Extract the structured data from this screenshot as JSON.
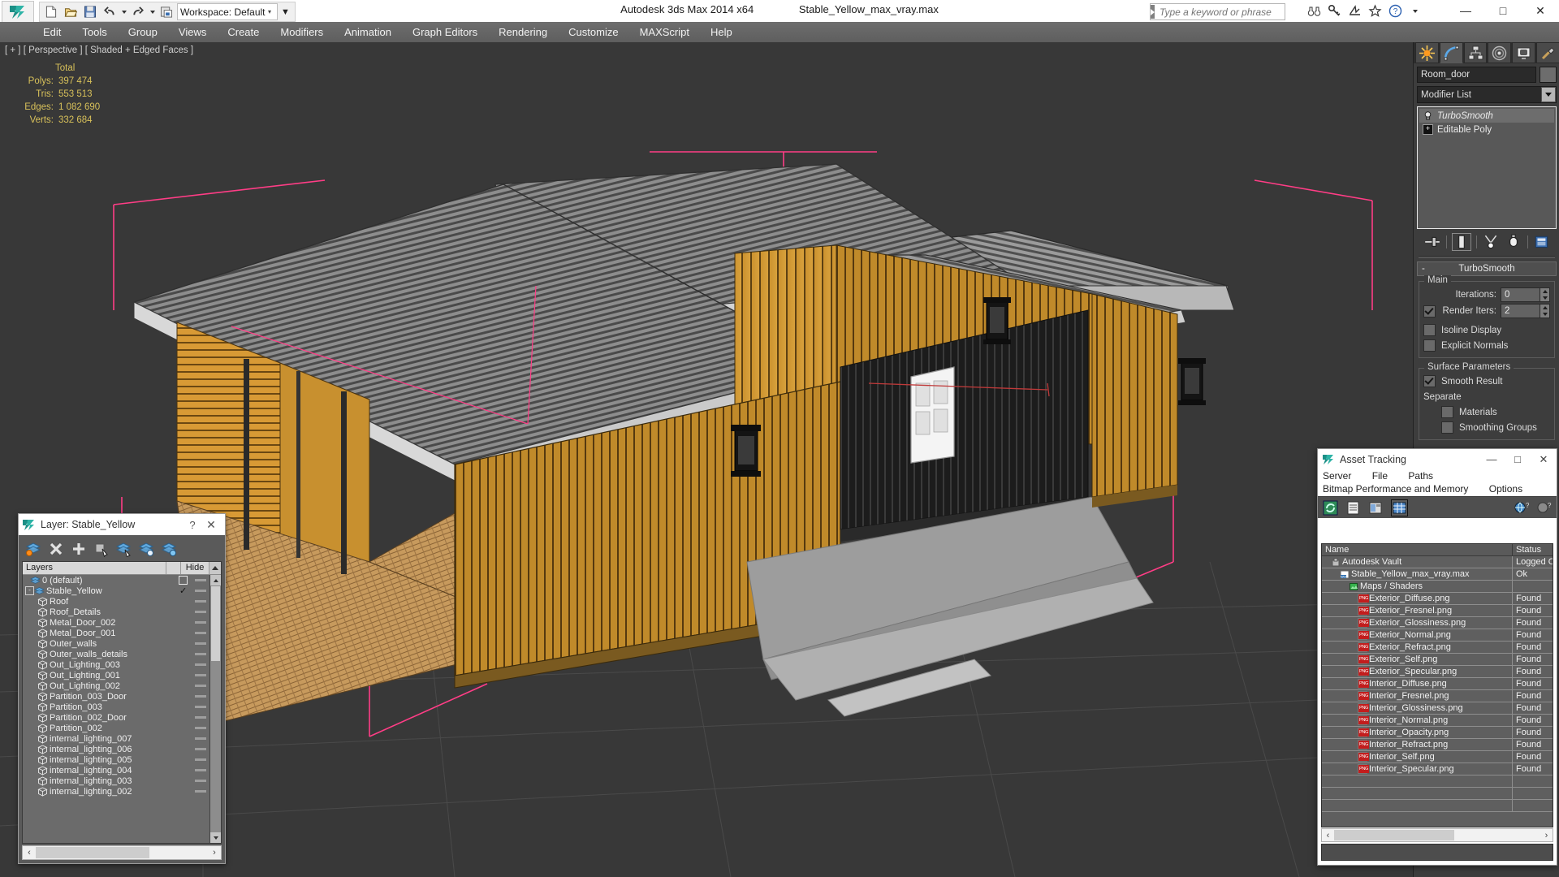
{
  "titlebar": {
    "workspace_label": "Workspace: Default",
    "app_title": "Autodesk 3ds Max  2014 x64",
    "file_title": "Stable_Yellow_max_vray.max",
    "search_placeholder": "Type a keyword or phrase",
    "minimize": "—",
    "maximize": "□",
    "close": "✕"
  },
  "menu": {
    "items": [
      "Edit",
      "Tools",
      "Group",
      "Views",
      "Create",
      "Modifiers",
      "Animation",
      "Graph Editors",
      "Rendering",
      "Customize",
      "MAXScript",
      "Help"
    ]
  },
  "viewport": {
    "label": "[ + ] [ Perspective ] [ Shaded + Edged Faces ]",
    "stats_header": "Total",
    "stats": [
      {
        "label": "Polys:",
        "value": "397 474"
      },
      {
        "label": "Tris:",
        "value": "553 513"
      },
      {
        "label": "Edges:",
        "value": "1 082 690"
      },
      {
        "label": "Verts:",
        "value": "332 684"
      }
    ]
  },
  "command_panel": {
    "object_name": "Room_door",
    "modifier_list_label": "Modifier List",
    "stack": [
      {
        "label": "TurboSmooth",
        "selected": true
      },
      {
        "label": "Editable Poly",
        "selected": false
      }
    ],
    "rollout_title": "TurboSmooth",
    "collapse_glyph": "-",
    "main_group": "Main",
    "iterations_label": "Iterations:",
    "iterations_value": "0",
    "render_iters_label": "Render Iters:",
    "render_iters_value": "2",
    "render_iters_checked": true,
    "isoline_label": "Isoline Display",
    "explicit_normals_label": "Explicit Normals",
    "surface_group": "Surface Parameters",
    "smooth_result_label": "Smooth Result",
    "separate_label": "Separate",
    "materials_label": "Materials",
    "smoothing_groups_label": "Smoothing Groups"
  },
  "layer_window": {
    "title": "Layer: Stable_Yellow",
    "help_glyph": "?",
    "close_glyph": "✕",
    "col_layers": "Layers",
    "col_hide": "Hide",
    "scroll_left": "‹",
    "scroll_right": "›",
    "rows": [
      {
        "name": "0 (default)",
        "indent": 1,
        "type": "layer",
        "mark": "box"
      },
      {
        "name": "Stable_Yellow",
        "indent": 0,
        "type": "layer",
        "mark": "check",
        "expander": "-"
      },
      {
        "name": "Roof",
        "indent": 2,
        "type": "object",
        "mark": ""
      },
      {
        "name": "Roof_Details",
        "indent": 2,
        "type": "object",
        "mark": ""
      },
      {
        "name": "Metal_Door_002",
        "indent": 2,
        "type": "object",
        "mark": ""
      },
      {
        "name": "Metal_Door_001",
        "indent": 2,
        "type": "object",
        "mark": ""
      },
      {
        "name": "Outer_walls",
        "indent": 2,
        "type": "object",
        "mark": ""
      },
      {
        "name": "Outer_walls_details",
        "indent": 2,
        "type": "object",
        "mark": ""
      },
      {
        "name": "Out_Lighting_003",
        "indent": 2,
        "type": "object",
        "mark": ""
      },
      {
        "name": "Out_Lighting_001",
        "indent": 2,
        "type": "object",
        "mark": ""
      },
      {
        "name": "Out_Lighting_002",
        "indent": 2,
        "type": "object",
        "mark": ""
      },
      {
        "name": "Partition_003_Door",
        "indent": 2,
        "type": "object",
        "mark": ""
      },
      {
        "name": "Partition_003",
        "indent": 2,
        "type": "object",
        "mark": ""
      },
      {
        "name": "Partition_002_Door",
        "indent": 2,
        "type": "object",
        "mark": ""
      },
      {
        "name": "Partition_002",
        "indent": 2,
        "type": "object",
        "mark": ""
      },
      {
        "name": "internal_lighting_007",
        "indent": 2,
        "type": "object",
        "mark": ""
      },
      {
        "name": "internal_lighting_006",
        "indent": 2,
        "type": "object",
        "mark": ""
      },
      {
        "name": "internal_lighting_005",
        "indent": 2,
        "type": "object",
        "mark": ""
      },
      {
        "name": "internal_lighting_004",
        "indent": 2,
        "type": "object",
        "mark": ""
      },
      {
        "name": "internal_lighting_003",
        "indent": 2,
        "type": "object",
        "mark": ""
      },
      {
        "name": "internal_lighting_002",
        "indent": 2,
        "type": "object",
        "mark": ""
      }
    ]
  },
  "asset_tracking": {
    "title": "Asset Tracking",
    "minimize": "—",
    "maximize": "□",
    "close": "✕",
    "menus_row1": [
      "Server",
      "File",
      "Paths"
    ],
    "menus_row2": [
      "Bitmap Performance and Memory",
      "Options"
    ],
    "col_name": "Name",
    "col_status": "Status",
    "scroll_left": "‹",
    "scroll_right": "›",
    "rows": [
      {
        "name": "Autodesk Vault",
        "status": "Logged O",
        "indent": 1,
        "icon": "vault-icon"
      },
      {
        "name": "Stable_Yellow_max_vray.max",
        "status": "Ok",
        "indent": 2,
        "icon": "max-file-icon"
      },
      {
        "name": "Maps / Shaders",
        "status": "",
        "indent": 3,
        "icon": "maps-icon"
      },
      {
        "name": "Exterior_Diffuse.png",
        "status": "Found",
        "indent": 4,
        "icon": "png-icon"
      },
      {
        "name": "Exterior_Fresnel.png",
        "status": "Found",
        "indent": 4,
        "icon": "png-icon"
      },
      {
        "name": "Exterior_Glossiness.png",
        "status": "Found",
        "indent": 4,
        "icon": "png-icon"
      },
      {
        "name": "Exterior_Normal.png",
        "status": "Found",
        "indent": 4,
        "icon": "png-icon"
      },
      {
        "name": "Exterior_Refract.png",
        "status": "Found",
        "indent": 4,
        "icon": "png-icon"
      },
      {
        "name": "Exterior_Self.png",
        "status": "Found",
        "indent": 4,
        "icon": "png-icon"
      },
      {
        "name": "Exterior_Specular.png",
        "status": "Found",
        "indent": 4,
        "icon": "png-icon"
      },
      {
        "name": "Interior_Diffuse.png",
        "status": "Found",
        "indent": 4,
        "icon": "png-icon"
      },
      {
        "name": "Interior_Fresnel.png",
        "status": "Found",
        "indent": 4,
        "icon": "png-icon"
      },
      {
        "name": "Interior_Glossiness.png",
        "status": "Found",
        "indent": 4,
        "icon": "png-icon"
      },
      {
        "name": "Interior_Normal.png",
        "status": "Found",
        "indent": 4,
        "icon": "png-icon"
      },
      {
        "name": "Interior_Opacity.png",
        "status": "Found",
        "indent": 4,
        "icon": "png-icon"
      },
      {
        "name": "Interior_Refract.png",
        "status": "Found",
        "indent": 4,
        "icon": "png-icon"
      },
      {
        "name": "Interior_Self.png",
        "status": "Found",
        "indent": 4,
        "icon": "png-icon"
      },
      {
        "name": "Interior_Specular.png",
        "status": "Found",
        "indent": 4,
        "icon": "png-icon"
      },
      {
        "name": "",
        "status": "",
        "indent": 0,
        "icon": ""
      },
      {
        "name": "",
        "status": "",
        "indent": 0,
        "icon": ""
      },
      {
        "name": "",
        "status": "",
        "indent": 0,
        "icon": ""
      }
    ]
  },
  "colors": {
    "viewport_bg": "#383838",
    "stats_text": "#d8c15a",
    "gizmo_pink": "#ff3a80",
    "wood_yellow": "#d19a35",
    "roof_grey": "#8c8c8c",
    "floor_grey": "#9a9a9a"
  }
}
